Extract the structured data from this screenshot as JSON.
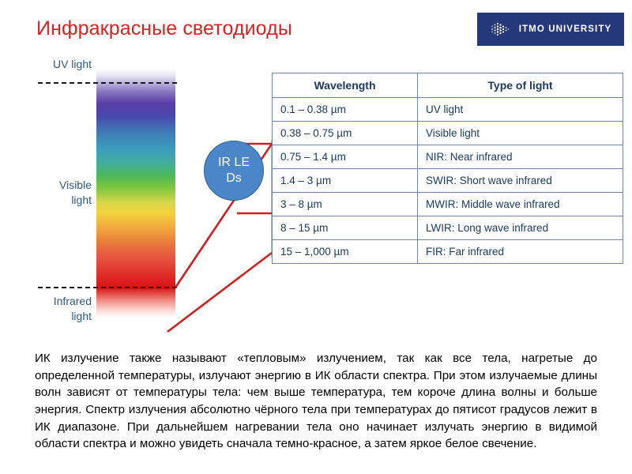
{
  "slide": {
    "title": "Инфракрасные светодиоды"
  },
  "logo": {
    "name": "ITMO UNIVERSITY",
    "background_color": "#24387a",
    "text_color": "#ffffff"
  },
  "spectrum": {
    "labels": {
      "uv": "UV light",
      "visible": "Visible\nlight",
      "visible_line1": "Visible",
      "visible_line2": "light",
      "infrared": "Infrared\nlight",
      "infrared_line1": "Infrared",
      "infrared_line2": "light"
    },
    "label_color": "#2e5a86",
    "dashed_line_color": "#1a1a1a"
  },
  "callout": {
    "label": "IR LEDs",
    "fill_color": "#4a86c8",
    "border_color": "#2f5f94",
    "text_color": "#ffffff"
  },
  "annotation": {
    "highlight_color": "#d02020"
  },
  "table": {
    "headers": [
      "Wavelength",
      "Type of light"
    ],
    "rows": [
      {
        "wavelength": "0.1 – 0.38 µm",
        "type": "UV light",
        "highlighted": false
      },
      {
        "wavelength": "0.38 – 0.75 µm",
        "type": "Visible light",
        "highlighted": false
      },
      {
        "wavelength": "0.75 – 1.4 µm",
        "type": "NIR: Near infrared",
        "highlighted": true
      },
      {
        "wavelength": "1.4 – 3 µm",
        "type": "SWIR: Short wave infrared",
        "highlighted": true
      },
      {
        "wavelength": "3 – 8 µm",
        "type": "MWIR: Middle wave infrared",
        "highlighted": true
      },
      {
        "wavelength": "8 – 15 µm",
        "type": "LWIR: Long wave infrared",
        "highlighted": true
      },
      {
        "wavelength": "15 – 1,000 µm",
        "type": "FIR: Far infrared",
        "highlighted": true
      }
    ]
  },
  "body": {
    "paragraph": "ИК излучение также называют «тепловым» излучением, так как все тела, нагретые до определенной температуры, излучают энергию в ИК области спектра. При этом излучаемые длины волн зависят от температуры тела: чем выше температура, тем короче длина волны и больше энергия. Спектр излучения абсолютно чёрного тела при температурах до пятисот градусов лежит в ИК диапазоне. При дальнейшем нагревании тела оно начинает излучать энергию в видимой области спектра и можно увидеть сначала темно-красное, а затем яркое белое свечение."
  }
}
